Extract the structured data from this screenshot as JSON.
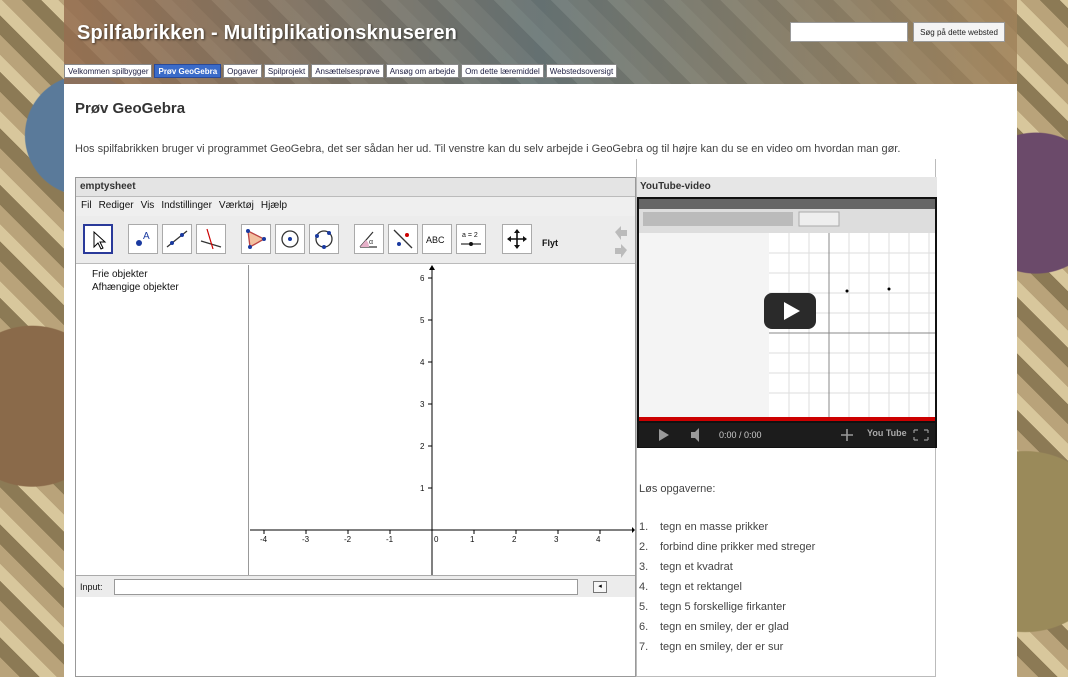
{
  "header": {
    "title": "Spilfabrikken - Multiplikationsknuseren",
    "search_button": "Søg på dette websted"
  },
  "nav": [
    {
      "label": "Velkommen spilbygger",
      "active": false
    },
    {
      "label": "Prøv GeoGebra",
      "active": true
    },
    {
      "label": "Opgaver",
      "active": false
    },
    {
      "label": "Spilprojekt",
      "active": false
    },
    {
      "label": "Ansættelsesprøve",
      "active": false
    },
    {
      "label": "Ansøg om arbejde",
      "active": false
    },
    {
      "label": "Om dette læremiddel",
      "active": false
    },
    {
      "label": "Webstedsoversigt",
      "active": false
    }
  ],
  "page": {
    "heading": "Prøv GeoGebra",
    "intro": "Hos spilfabrikken bruger vi programmet GeoGebra, det ser sådan her ud. Til venstre kan du selv arbejde i GeoGebra og til højre kan du se en video om hvordan man gør."
  },
  "geogebra": {
    "window_title": "emptysheet",
    "menu": [
      "Fil",
      "Rediger",
      "Vis",
      "Indstillinger",
      "Værktøj",
      "Hjælp"
    ],
    "tools": [
      "move-tool",
      "point-tool",
      "line-tool",
      "perpendicular-tool",
      "polygon-tool",
      "circle-center-tool",
      "circle-three-points-tool",
      "angle-tool",
      "reflect-tool",
      "text-tool",
      "slider-tool",
      "move-view-tool"
    ],
    "text_tool_label": "ABC",
    "slider_tool_label": "a = 2",
    "active_tool_name": "Flyt",
    "algebra": [
      "Frie objekter",
      "Afhængige objekter"
    ],
    "x_ticks": [
      "-4",
      "-3",
      "-2",
      "-1",
      "0",
      "1",
      "2",
      "3",
      "4"
    ],
    "y_ticks": [
      "1",
      "2",
      "3",
      "4",
      "5",
      "6"
    ],
    "input_label": "Input:"
  },
  "video": {
    "title": "YouTube-video",
    "time": "0:00 / 0:00",
    "logo": "You Tube"
  },
  "tasks": {
    "heading": "Løs opgaverne:",
    "items": [
      {
        "num": "1.",
        "text": "tegn en masse prikker"
      },
      {
        "num": "2.",
        "text": "forbind dine prikker med streger"
      },
      {
        "num": "3.",
        "text": "tegn et kvadrat"
      },
      {
        "num": "4.",
        "text": "tegn et rektangel"
      },
      {
        "num": "5.",
        "text": "tegn 5 forskellige firkanter"
      },
      {
        "num": "6.",
        "text": "tegn en smiley, der er glad"
      },
      {
        "num": "7.",
        "text": "tegn en smiley, der er sur"
      }
    ]
  }
}
